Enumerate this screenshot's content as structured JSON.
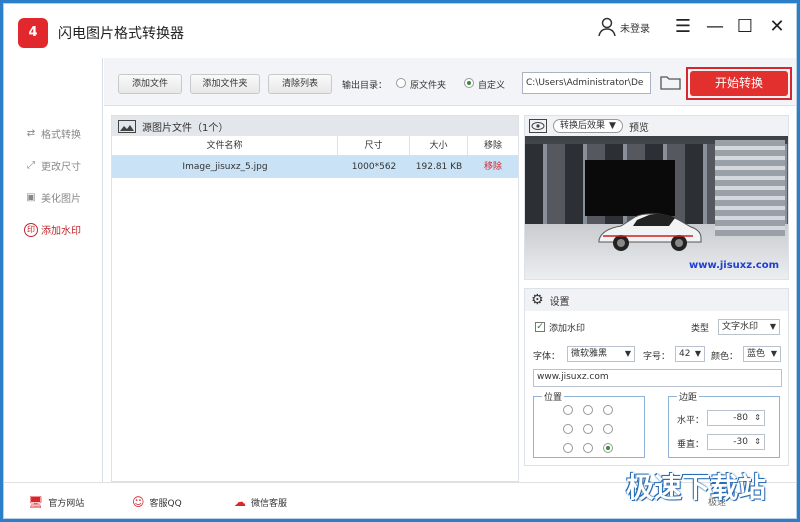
{
  "app": {
    "title": "闪电图片格式转换器",
    "logo": "4",
    "login": "未登录"
  },
  "window": {
    "menu": "☰",
    "minimize": "—",
    "maximize": "☐",
    "close": "✕"
  },
  "sidebar": {
    "items": [
      {
        "label": "格式转换",
        "icon": "⇄"
      },
      {
        "label": "更改尺寸",
        "icon": "⤢"
      },
      {
        "label": "美化图片",
        "icon": "▣"
      },
      {
        "label": "添加水印",
        "icon": "印"
      }
    ]
  },
  "toolbar": {
    "add_file": "添加文件",
    "add_folder": "添加文件夹",
    "clear_list": "清除列表",
    "output_label": "输出目录：",
    "opt_original": "原文件夹",
    "opt_custom": "自定义",
    "path": "C:\\Users\\Administrator\\De",
    "start": "开始转换"
  },
  "list": {
    "title": "源图片文件（1个）",
    "columns": [
      "文件名称",
      "尺寸",
      "大小",
      "移除"
    ],
    "rows": [
      {
        "name": "Image_jisuxz_5.jpg",
        "size": "1000*562",
        "bytes": "192.81 KB",
        "remove": "移除"
      }
    ]
  },
  "preview": {
    "mode": "转换后效果",
    "label": "预览",
    "watermark": "www.jisuxz.com"
  },
  "settings": {
    "title": "设置",
    "add_watermark": "添加水印",
    "type_label": "类型",
    "type_value": "文字水印",
    "font_label": "字体：",
    "font_value": "微软雅黑",
    "size_label": "字号：",
    "size_value": "42",
    "color_label": "颜色：",
    "color_value": "蓝色",
    "text": "www.jisuxz.com",
    "position_label": "位置",
    "margin_label": "边距",
    "h_label": "水平：",
    "h_value": "-80",
    "v_label": "垂直：",
    "v_value": "-30"
  },
  "footer": {
    "website": "官方网站",
    "qq": "客服QQ",
    "wechat": "微信客服",
    "right": "极速"
  },
  "watermark_site": "极速下载站",
  "colors": {
    "accent": "#e2302f",
    "selected_row": "#c9e2f5",
    "link_red": "#d8262b"
  }
}
